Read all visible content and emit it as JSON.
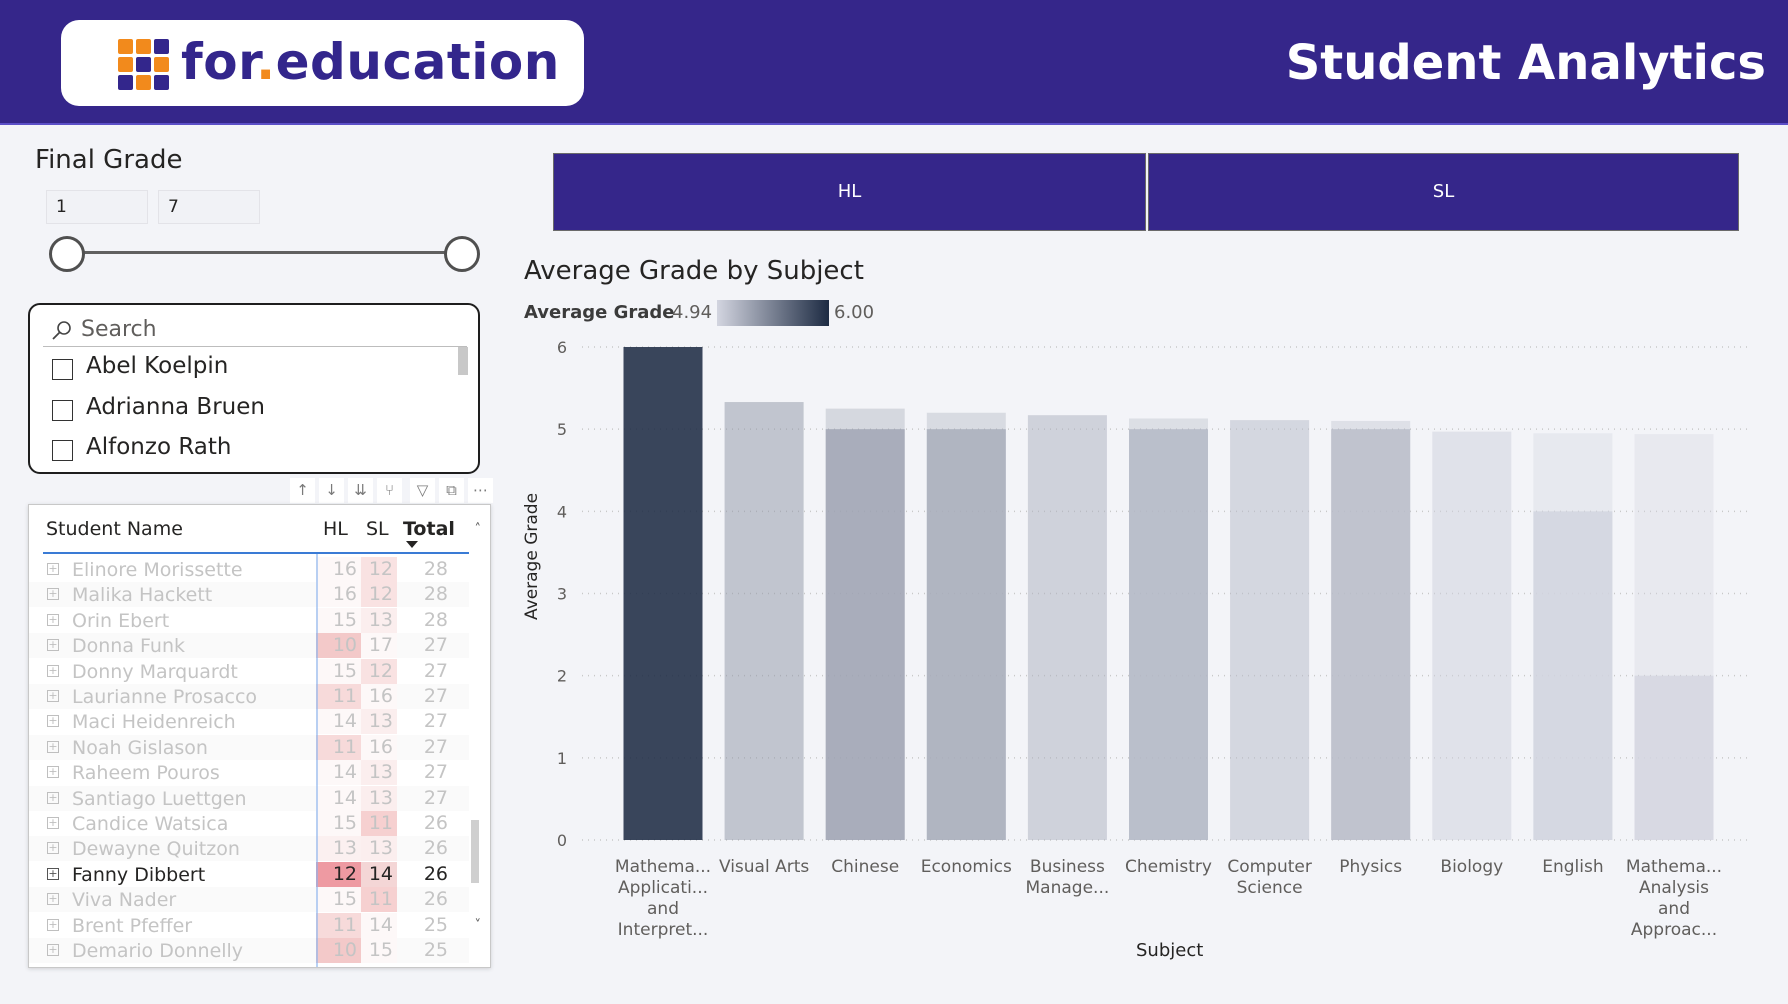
{
  "header": {
    "logo_text_a": "for",
    "logo_text_dot": ".",
    "logo_text_b": "education",
    "title": "Student Analytics",
    "logo_colors": [
      "#f28a1c",
      "#f28a1c",
      "#33268c",
      "#f28a1c",
      "#33268c",
      "#f28a1c",
      "#33268c",
      "#f28a1c",
      "#33268c"
    ]
  },
  "final_grade": {
    "title": "Final Grade",
    "min_value": "1",
    "max_value": "7"
  },
  "name_slicer": {
    "search_placeholder": "Search",
    "items": [
      "Abel Koelpin",
      "Adrianna Bruen",
      "Alfonzo Rath"
    ]
  },
  "matrix": {
    "col_name": "Student Name",
    "col_hl": "HL",
    "col_sl": "SL",
    "col_total": "Total",
    "rows": [
      {
        "name": "Elinore Morissette",
        "hl": "16",
        "sl": "12",
        "total": "28",
        "selected": false
      },
      {
        "name": "Malika Hackett",
        "hl": "16",
        "sl": "12",
        "total": "28",
        "selected": false
      },
      {
        "name": "Orin Ebert",
        "hl": "15",
        "sl": "13",
        "total": "28",
        "selected": false
      },
      {
        "name": "Donna Funk",
        "hl": "10",
        "sl": "17",
        "total": "27",
        "selected": false
      },
      {
        "name": "Donny Marquardt",
        "hl": "15",
        "sl": "12",
        "total": "27",
        "selected": false
      },
      {
        "name": "Laurianne Prosacco",
        "hl": "11",
        "sl": "16",
        "total": "27",
        "selected": false
      },
      {
        "name": "Maci Heidenreich",
        "hl": "14",
        "sl": "13",
        "total": "27",
        "selected": false
      },
      {
        "name": "Noah Gislason",
        "hl": "11",
        "sl": "16",
        "total": "27",
        "selected": false
      },
      {
        "name": "Raheem Pouros",
        "hl": "14",
        "sl": "13",
        "total": "27",
        "selected": false
      },
      {
        "name": "Santiago Luettgen",
        "hl": "14",
        "sl": "13",
        "total": "27",
        "selected": false
      },
      {
        "name": "Candice Watsica",
        "hl": "15",
        "sl": "11",
        "total": "26",
        "selected": false
      },
      {
        "name": "Dewayne Quitzon",
        "hl": "13",
        "sl": "13",
        "total": "26",
        "selected": false
      },
      {
        "name": "Fanny Dibbert",
        "hl": "12",
        "sl": "14",
        "total": "26",
        "selected": true
      },
      {
        "name": "Viva Nader",
        "hl": "15",
        "sl": "11",
        "total": "26",
        "selected": false
      },
      {
        "name": "Brent Pfeffer",
        "hl": "11",
        "sl": "14",
        "total": "25",
        "selected": false
      },
      {
        "name": "Demario Donnelly",
        "hl": "10",
        "sl": "15",
        "total": "25",
        "selected": false
      }
    ]
  },
  "tabs": {
    "hl": "HL",
    "sl": "SL"
  },
  "chart_data": {
    "type": "bar",
    "title": "Average Grade by Subject",
    "legend_title": "Average Grade",
    "legend_min": "4.94",
    "legend_max": "6.00",
    "xlabel": "Subject",
    "ylabel": "Average Grade",
    "ylim": [
      0,
      6
    ],
    "yticks": [
      0,
      1,
      2,
      3,
      4,
      5,
      6
    ],
    "grid": true,
    "categories": [
      [
        "Mathema...",
        "Applicati...",
        "and",
        "Interpret..."
      ],
      [
        "Visual Arts"
      ],
      [
        "Chinese"
      ],
      [
        "Economics"
      ],
      [
        "Business",
        "Manage..."
      ],
      [
        "Chemistry"
      ],
      [
        "Computer",
        "Science"
      ],
      [
        "Physics"
      ],
      [
        "Biology"
      ],
      [
        "English"
      ],
      [
        "Mathema...",
        "Analysis",
        "and",
        "Approac..."
      ]
    ],
    "values": [
      6.0,
      5.33,
      5.25,
      5.2,
      5.17,
      5.13,
      5.11,
      5.1,
      4.97,
      4.95,
      4.94
    ],
    "highlight_values": [
      6.0,
      null,
      5.0,
      5.0,
      null,
      5.0,
      null,
      5.0,
      null,
      4.0,
      2.0
    ],
    "color_low": "#d3d5e0",
    "color_high": "#1d2b43"
  }
}
